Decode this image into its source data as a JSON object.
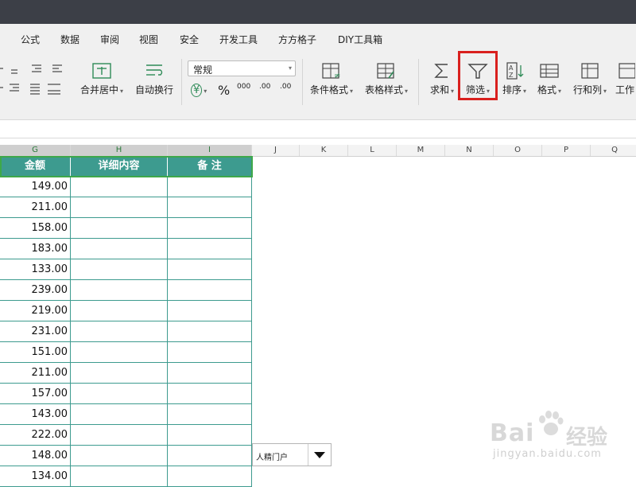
{
  "menu": [
    "公式",
    "数据",
    "审阅",
    "视图",
    "安全",
    "开发工具",
    "方方格子",
    "DIY工具箱"
  ],
  "toolbar": {
    "merge_label": "合并居中",
    "wrap_label": "自动换行",
    "number_format": "常规",
    "currency_symbol": "¥",
    "percent_symbol": "%",
    "thousands_symbol": "000",
    "decimal_increase": ".00",
    "decimal_decrease": ".00",
    "conditional_label": "条件格式",
    "table_style_label": "表格样式",
    "sum_label": "求和",
    "filter_label": "筛选",
    "sort_label": "排序",
    "format_label": "格式",
    "rowcol_label": "行和列",
    "worksheet_label": "工作"
  },
  "columns": [
    "G",
    "H",
    "I",
    "J",
    "K",
    "L",
    "M",
    "N",
    "O",
    "P",
    "Q"
  ],
  "table": {
    "headers": [
      "金额",
      "详细内容",
      "备 注"
    ],
    "amounts": [
      "149.00",
      "211.00",
      "158.00",
      "183.00",
      "133.00",
      "239.00",
      "219.00",
      "231.00",
      "151.00",
      "211.00",
      "157.00",
      "143.00",
      "222.00",
      "148.00",
      "134.00"
    ]
  },
  "dropdown": {
    "value": "人精门户"
  },
  "watermark": {
    "brand": "Bai",
    "brand2": "经验",
    "url": "jingyan.baidu.com"
  },
  "colors": {
    "header_teal": "#3d9b8f",
    "highlight_red": "#d9201e",
    "titlebar": "#3c3f47"
  }
}
